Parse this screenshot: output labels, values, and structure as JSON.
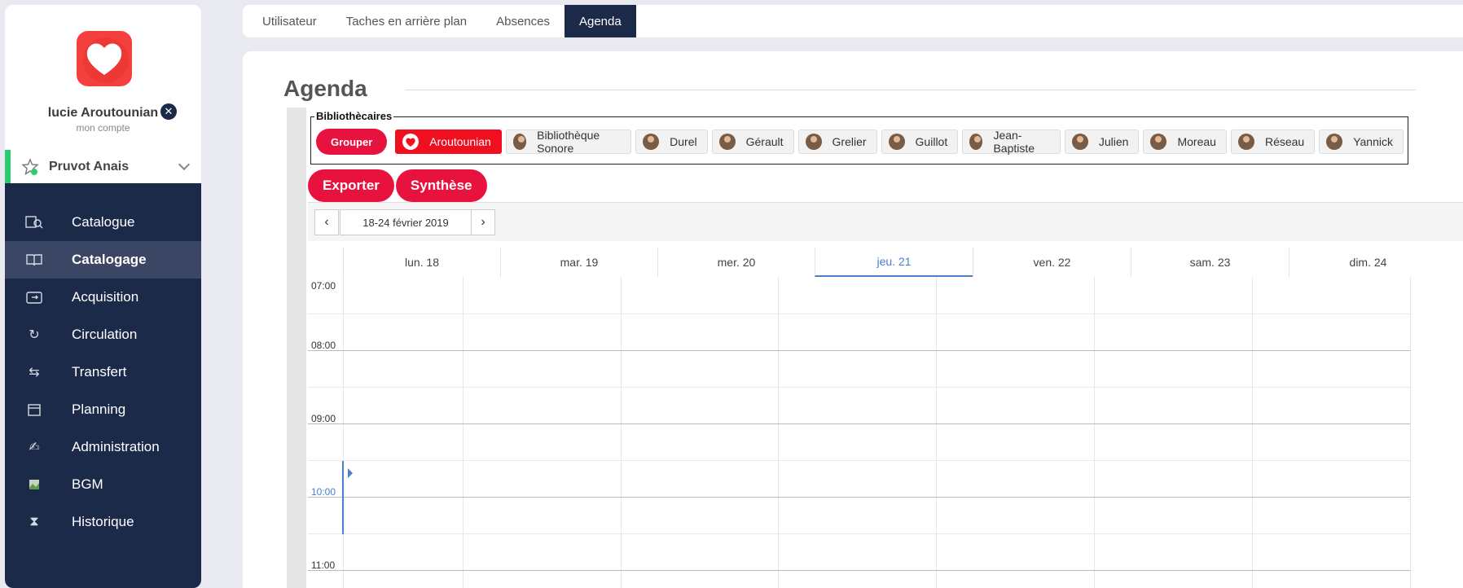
{
  "user": {
    "name": "lucie Aroutounian",
    "account": "mon compte",
    "close_icon": "close-icon"
  },
  "profile": {
    "name": "Pruvot Anais"
  },
  "nav": [
    {
      "label": "Catalogue",
      "icon": "catalog-search-icon"
    },
    {
      "label": "Catalogage",
      "icon": "open-book-icon",
      "active": true
    },
    {
      "label": "Acquisition",
      "icon": "inbox-icon"
    },
    {
      "label": "Circulation",
      "icon": "refresh-icon"
    },
    {
      "label": "Transfert",
      "icon": "transfer-arrows-icon"
    },
    {
      "label": "Planning",
      "icon": "calendar-icon"
    },
    {
      "label": "Administration",
      "icon": "pen-signature-icon"
    },
    {
      "label": "BGM",
      "icon": "broken-image-icon"
    },
    {
      "label": "Historique",
      "icon": "hourglass-icon"
    }
  ],
  "tabs": [
    "Utilisateur",
    "Taches en arrière plan",
    "Absences",
    "Agenda"
  ],
  "active_tab": "Agenda",
  "page": {
    "title": "Agenda"
  },
  "biblio": {
    "legend": "Bibliothècaires",
    "group_button": "Grouper",
    "librarians": [
      "Aroutounian",
      "Bibliothèque Sonore",
      "Durel",
      "Gérault",
      "Grelier",
      "Guillot",
      "Jean-Baptiste",
      "Julien",
      "Moreau",
      "Réseau",
      "Yannick"
    ]
  },
  "actions": {
    "export": "Exporter",
    "synthesis": "Synthèse"
  },
  "calendar": {
    "range": "18-24 février 2019",
    "prev": "‹",
    "next": "›",
    "days": [
      "lun. 18",
      "mar. 19",
      "mer. 20",
      "jeu. 21",
      "ven. 22",
      "sam. 23",
      "dim. 24"
    ],
    "today_index": 3,
    "hours": [
      "07:00",
      "08:00",
      "09:00",
      "10:00",
      "11:00"
    ],
    "current_hour": "10:00"
  },
  "colors": {
    "accent": "#e8123f",
    "navy": "#1c2a4a",
    "today": "#4a7ed0"
  }
}
